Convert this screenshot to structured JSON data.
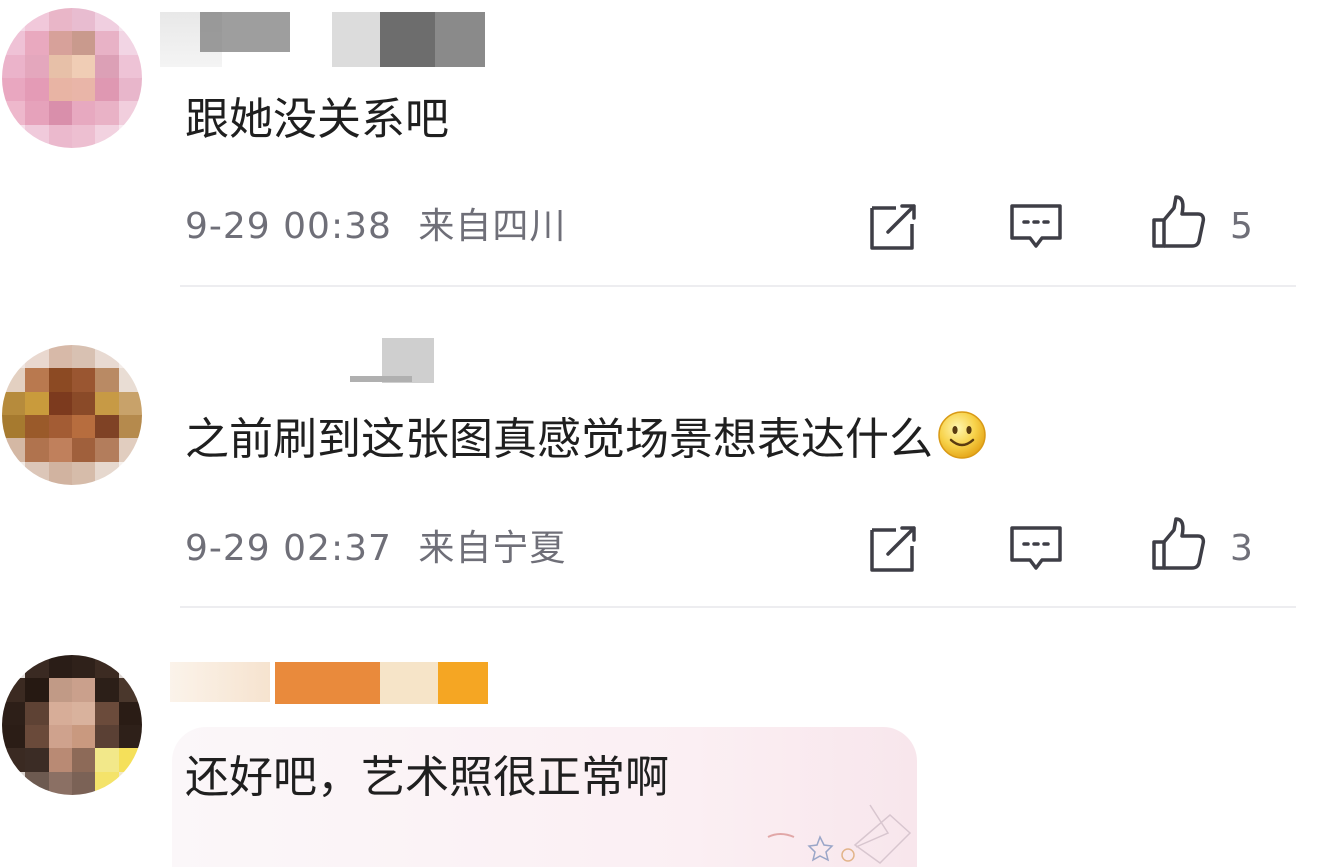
{
  "comments": [
    {
      "text": "跟她没关系吧",
      "time": "9-29 00:38",
      "location": "来自四川",
      "likes": "5"
    },
    {
      "text": "之前刷到这张图真感觉场景想表达什么",
      "time": "9-29 02:37",
      "location": "来自宁夏",
      "likes": "3"
    },
    {
      "text": "还好吧，艺术照很正常啊"
    }
  ],
  "icons": {
    "share": "share-icon",
    "comment": "comment-icon",
    "like": "thumbs-up-icon",
    "emoji": "smiley-emoji"
  },
  "colors": {
    "text": "#1f1f1f",
    "meta": "#6f6f78",
    "divider": "#ededf0"
  }
}
